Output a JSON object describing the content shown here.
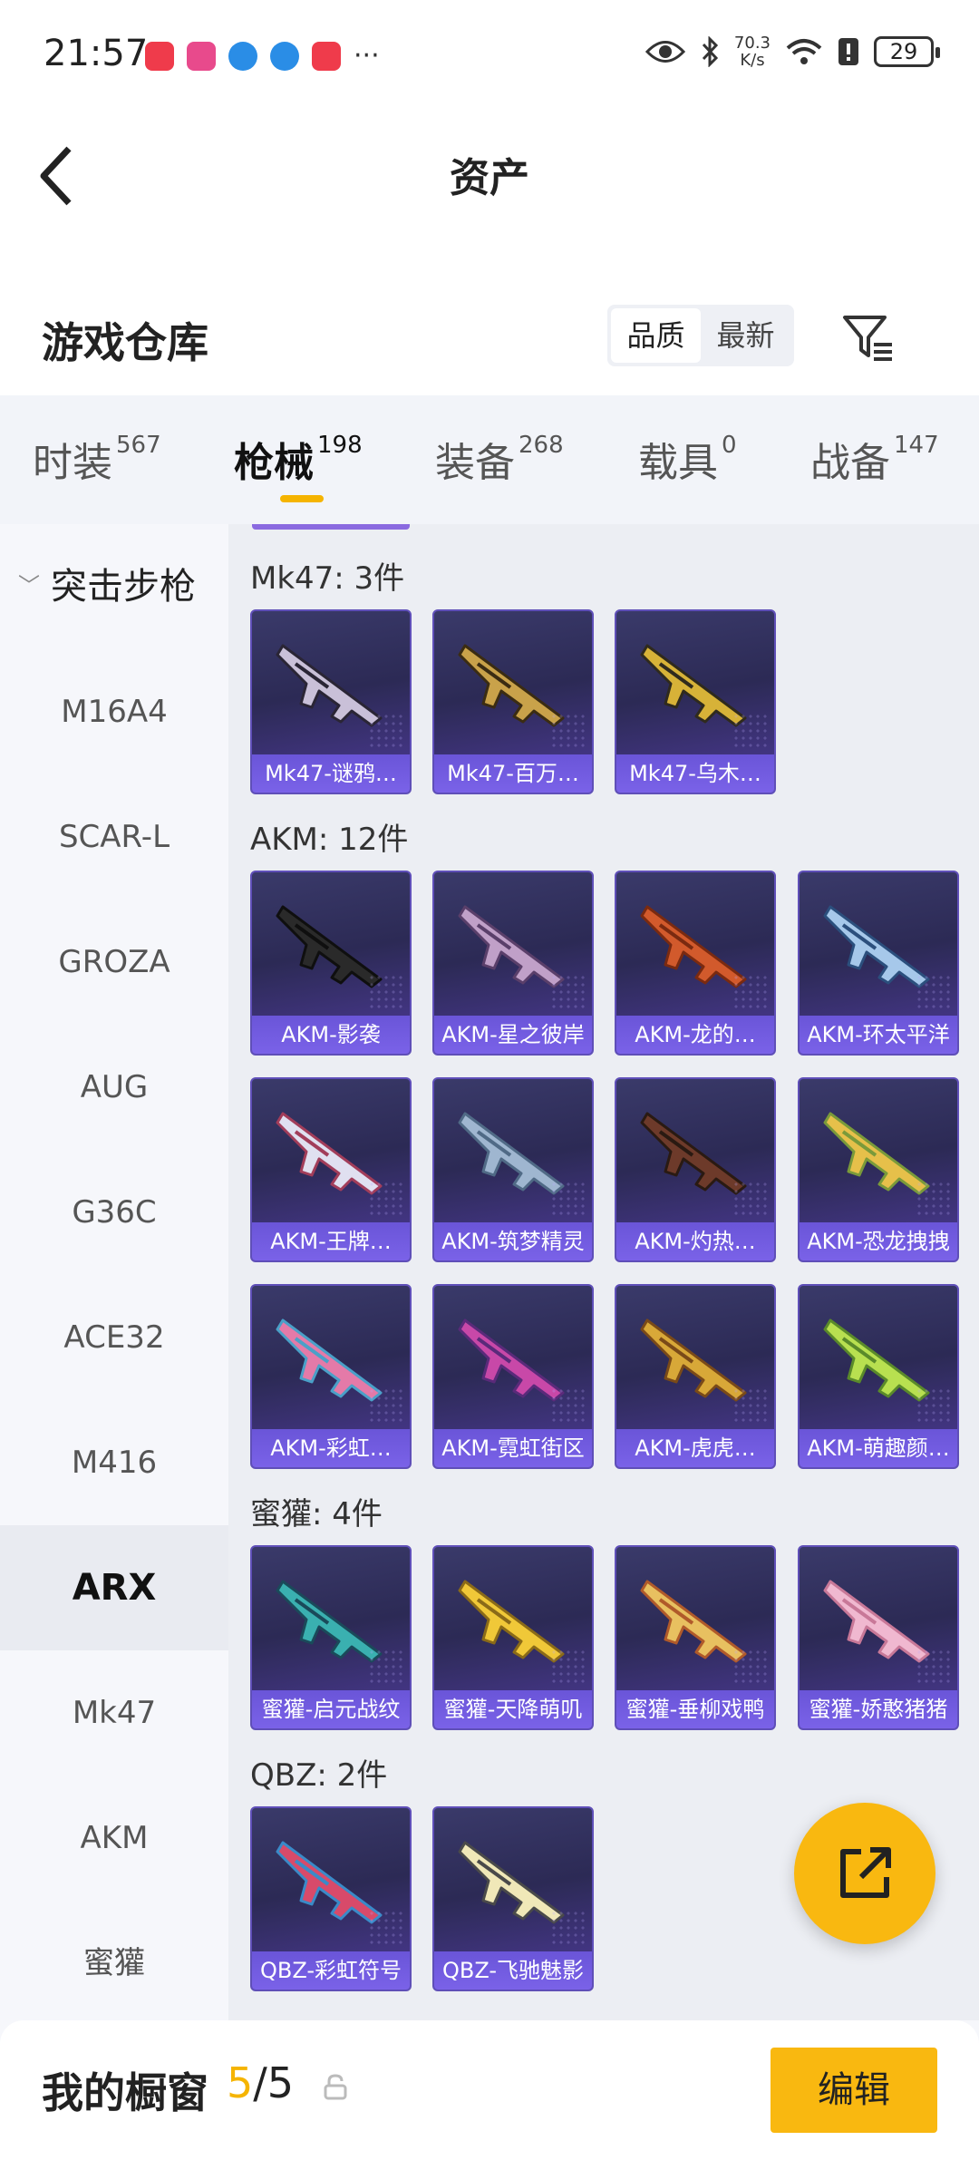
{
  "status_bar": {
    "time": "21:57",
    "speed_value": "70.3",
    "speed_unit": "K/s",
    "battery": "29",
    "more": "···",
    "app_colors": [
      "#ef3b4b",
      "#e84a8c",
      "#2a8de6",
      "#2a8de6",
      "#ef3b4b"
    ]
  },
  "header": {
    "title": "资产"
  },
  "warehouse": {
    "title": "游戏仓库",
    "sort_options": [
      "品质",
      "最新"
    ],
    "active_sort": "品质"
  },
  "tabs": [
    {
      "label": "时装",
      "count": "567"
    },
    {
      "label": "枪械",
      "count": "198",
      "active": true
    },
    {
      "label": "装备",
      "count": "268"
    },
    {
      "label": "载具",
      "count": "0"
    },
    {
      "label": "战备",
      "count": "147"
    }
  ],
  "sidebar": {
    "group": "突击步枪",
    "items": [
      "M16A4",
      "SCAR-L",
      "GROZA",
      "AUG",
      "G36C",
      "ACE32",
      "M416",
      "ARX",
      "Mk47",
      "AKM",
      "蜜獾"
    ],
    "active": "ARX"
  },
  "sections": [
    {
      "title": "Mk47: 3件",
      "items": [
        "Mk47-谜鸦…",
        "Mk47-百万…",
        "Mk47-乌木…"
      ]
    },
    {
      "title": "AKM: 12件",
      "items": [
        "AKM-影袭",
        "AKM-星之彼岸",
        "AKM-龙的…",
        "AKM-环太平洋",
        "AKM-王牌…",
        "AKM-筑梦精灵",
        "AKM-灼热…",
        "AKM-恐龙拽拽",
        "AKM-彩虹…",
        "AKM-霓虹街区",
        "AKM-虎虎…",
        "AKM-萌趣颜…"
      ]
    },
    {
      "title": "蜜獾: 4件",
      "items": [
        "蜜獾-启元战纹",
        "蜜獾-天降萌叽",
        "蜜獾-垂柳戏鸭",
        "蜜獾-娇憨猪猪"
      ]
    },
    {
      "title": "QBZ: 2件",
      "items": [
        "QBZ-彩虹符号",
        "QBZ-飞驰魅影"
      ]
    }
  ],
  "bottom": {
    "title": "我的橱窗",
    "current": "5",
    "separator": "/",
    "total": "5",
    "edit_label": "编辑"
  }
}
